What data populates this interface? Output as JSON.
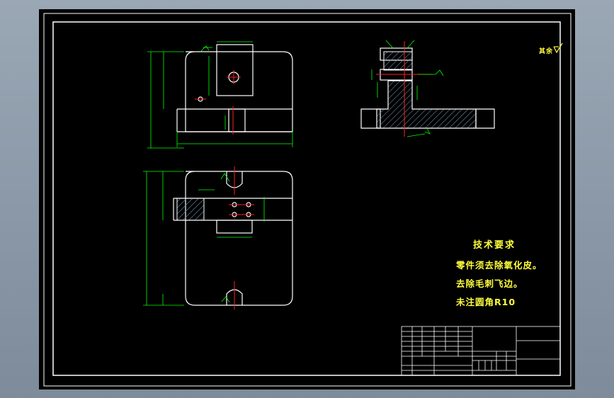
{
  "technical_requirements": {
    "title": "技术要求",
    "notes": [
      "零件须去除氧化皮。",
      "去除毛刺飞边。",
      "未注圆角R10"
    ]
  },
  "surface_roughness_note": "其余",
  "colors": {
    "background": "#000000",
    "frame": "#ffffff",
    "outline": "#ffffff",
    "dimension": "#00ff00",
    "center_line": "#ff2020",
    "hatch": "#6b8ca8",
    "note_text": "#ffff3c"
  }
}
